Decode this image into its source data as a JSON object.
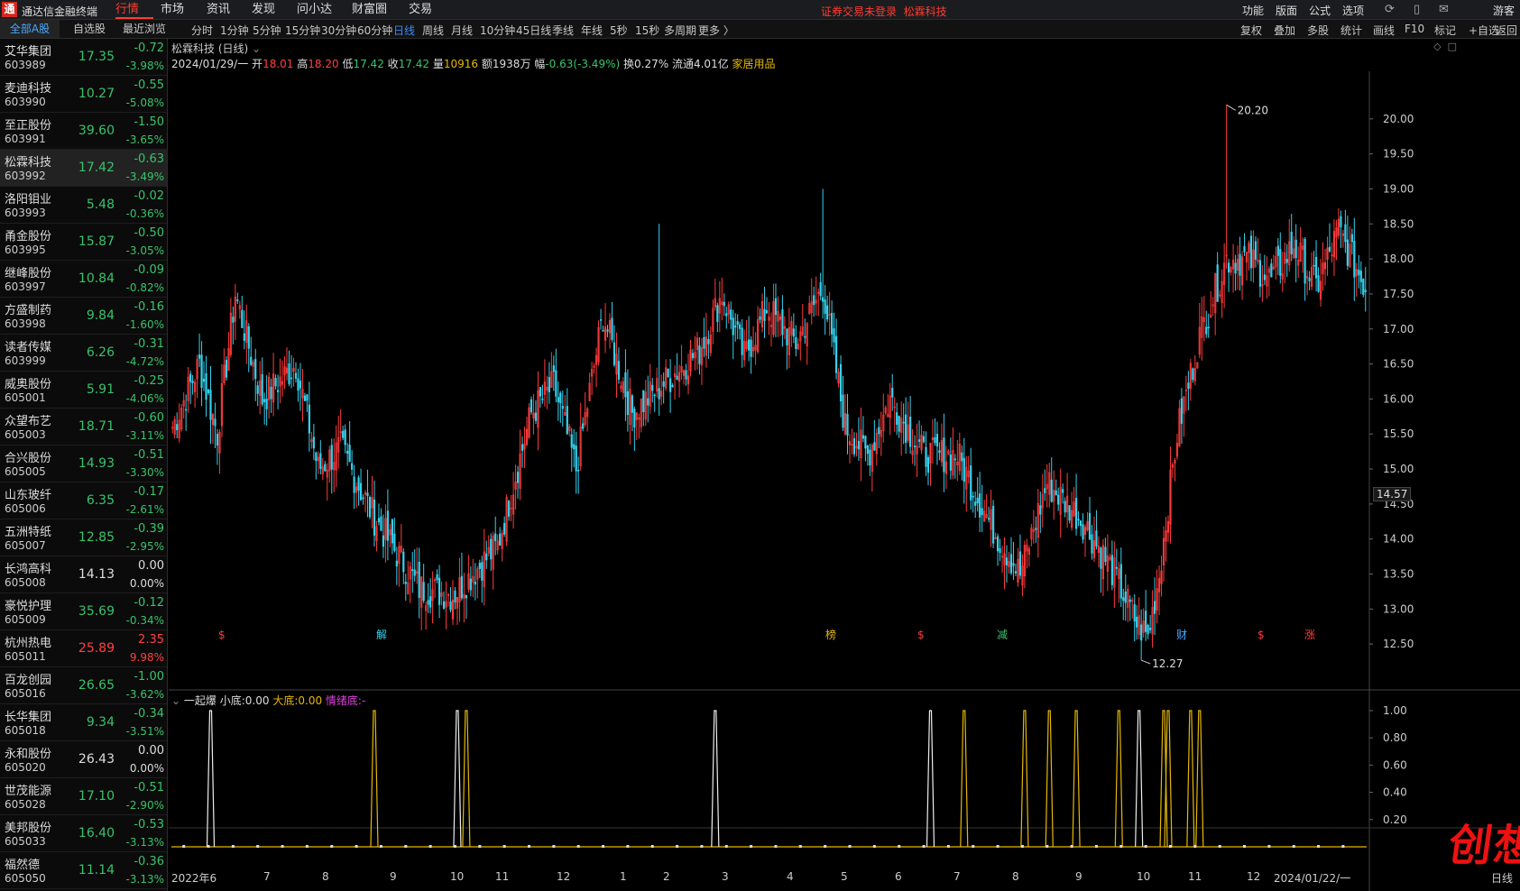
{
  "menubar": {
    "logo": "通",
    "title": "通达信金融终端",
    "items": [
      "行情",
      "市场",
      "资讯",
      "发现",
      "问小达",
      "财富圈",
      "交易"
    ],
    "active": "行情",
    "login_notice": "证券交易未登录",
    "stock_name": "松霖科技",
    "right": [
      "功能",
      "版面",
      "公式",
      "选项"
    ],
    "guest": "游客"
  },
  "subbar": {
    "tabs": [
      "全部A股",
      "自选股",
      "最近浏览"
    ],
    "periods": [
      "分时",
      "1分钟",
      "5分钟",
      "15分钟",
      "30分钟",
      "60分钟",
      "日线",
      "周线",
      "月线",
      "10分钟",
      "45日线",
      "季线",
      "年线",
      "5秒",
      "15秒",
      "多周期",
      "更多 〉"
    ],
    "active_period": "日线",
    "tools": [
      "复权",
      "叠加",
      "多股",
      "统计",
      "画线",
      "F10",
      "标记",
      "+自选",
      "返回"
    ]
  },
  "stocks": [
    {
      "name": "艾华集团",
      "code": "603989",
      "price": "17.35",
      "change": "-0.72",
      "pct": "-3.98%"
    },
    {
      "name": "麦迪科技",
      "code": "603990",
      "price": "10.27",
      "change": "-0.55",
      "pct": "-5.08%"
    },
    {
      "name": "至正股份",
      "code": "603991",
      "price": "39.60",
      "change": "-1.50",
      "pct": "-3.65%"
    },
    {
      "name": "松霖科技",
      "code": "603992",
      "price": "17.42",
      "change": "-0.63",
      "pct": "-3.49%"
    },
    {
      "name": "洛阳钼业",
      "code": "603993",
      "price": "5.48",
      "change": "-0.02",
      "pct": "-0.36%"
    },
    {
      "name": "甬金股份",
      "code": "603995",
      "price": "15.87",
      "change": "-0.50",
      "pct": "-3.05%"
    },
    {
      "name": "继峰股份",
      "code": "603997",
      "price": "10.84",
      "change": "-0.09",
      "pct": "-0.82%"
    },
    {
      "name": "方盛制药",
      "code": "603998",
      "price": "9.84",
      "change": "-0.16",
      "pct": "-1.60%"
    },
    {
      "name": "读者传媒",
      "code": "603999",
      "price": "6.26",
      "change": "-0.31",
      "pct": "-4.72%"
    },
    {
      "name": "威奥股份",
      "code": "605001",
      "price": "5.91",
      "change": "-0.25",
      "pct": "-4.06%"
    },
    {
      "name": "众望布艺",
      "code": "605003",
      "price": "18.71",
      "change": "-0.60",
      "pct": "-3.11%"
    },
    {
      "name": "合兴股份",
      "code": "605005",
      "price": "14.93",
      "change": "-0.51",
      "pct": "-3.30%"
    },
    {
      "name": "山东玻纤",
      "code": "605006",
      "price": "6.35",
      "change": "-0.17",
      "pct": "-2.61%"
    },
    {
      "name": "五洲特纸",
      "code": "605007",
      "price": "12.85",
      "change": "-0.39",
      "pct": "-2.95%"
    },
    {
      "name": "长鸿高科",
      "code": "605008",
      "price": "14.13",
      "change": "0.00",
      "pct": "0.00%"
    },
    {
      "name": "豪悦护理",
      "code": "605009",
      "price": "35.69",
      "change": "-0.12",
      "pct": "-0.34%"
    },
    {
      "name": "杭州热电",
      "code": "605011",
      "price": "25.89",
      "change": "2.35",
      "pct": "9.98%"
    },
    {
      "name": "百龙创园",
      "code": "605016",
      "price": "26.65",
      "change": "-1.00",
      "pct": "-3.62%"
    },
    {
      "name": "长华集团",
      "code": "605018",
      "price": "9.34",
      "change": "-0.34",
      "pct": "-3.51%"
    },
    {
      "name": "永和股份",
      "code": "605020",
      "price": "26.43",
      "change": "0.00",
      "pct": "0.00%"
    },
    {
      "name": "世茂能源",
      "code": "605028",
      "price": "17.10",
      "change": "-0.51",
      "pct": "-2.90%"
    },
    {
      "name": "美邦股份",
      "code": "605033",
      "price": "16.40",
      "change": "-0.53",
      "pct": "-3.13%"
    },
    {
      "name": "福然德",
      "code": "605050",
      "price": "11.14",
      "change": "-0.36",
      "pct": "-3.13%"
    }
  ],
  "chart": {
    "title": "松霖科技 (日线)",
    "date": "2024/01/29/一",
    "open_label": "开",
    "open": "18.01",
    "high_label": "高",
    "high": "18.20",
    "low_label": "低",
    "low": "17.42",
    "close_label": "收",
    "close": "17.42",
    "vol_label": "量",
    "vol": "10916",
    "amt_label": "额",
    "amt": "1938万",
    "amp_label": "幅",
    "amp": "-0.63(-3.49%)",
    "turn_label": "换",
    "turn": "0.27%",
    "float_label": "流通",
    "float": "4.01亿",
    "sector": "家居用品",
    "last_price": "14.57",
    "max_label": "20.20",
    "min_label": "12.27"
  },
  "indicator": {
    "name": "一起爆",
    "xiao_label": "小底:",
    "xiao": "0.00",
    "da_label": "大底:",
    "da": "0.00",
    "qx_label": "情绪底:",
    "qx": "-"
  },
  "events": [
    {
      "t": "$"
    },
    {
      "t": "解"
    },
    {
      "t": "榜"
    },
    {
      "t": "$"
    },
    {
      "t": "减"
    },
    {
      "t": "财"
    },
    {
      "t": "$"
    },
    {
      "t": "涨"
    }
  ],
  "x_axis": {
    "labels": [
      "2022年6",
      "7",
      "8",
      "9",
      "10",
      "11",
      "12",
      "1",
      "2",
      "3",
      "4",
      "5",
      "6",
      "7",
      "8",
      "9",
      "10",
      "11",
      "12",
      "2024/01/22/一"
    ],
    "period": "日线"
  },
  "chart_data": {
    "type": "candlestick",
    "price_axis": {
      "ticks": [
        12.5,
        13.0,
        13.5,
        14.0,
        14.5,
        15.0,
        15.5,
        16.0,
        16.5,
        17.0,
        17.5,
        18.0,
        18.5,
        19.0,
        19.5,
        20.0
      ],
      "ylim": [
        12.0,
        20.5
      ]
    },
    "indicator_axis": {
      "ticks": [
        0.2,
        0.4,
        0.6,
        0.8,
        1.0
      ],
      "ylim": [
        0,
        1
      ]
    },
    "anchors": [
      [
        0,
        15.6
      ],
      [
        12,
        16.5
      ],
      [
        20,
        15.5
      ],
      [
        28,
        17.5
      ],
      [
        40,
        16.0
      ],
      [
        55,
        16.5
      ],
      [
        65,
        15.0
      ],
      [
        75,
        15.3
      ],
      [
        90,
        14.3
      ],
      [
        110,
        13.3
      ],
      [
        125,
        13.2
      ],
      [
        145,
        13.9
      ],
      [
        160,
        15.8
      ],
      [
        170,
        16.2
      ],
      [
        180,
        15.0
      ],
      [
        192,
        17.2
      ],
      [
        205,
        15.8
      ],
      [
        215,
        16.1
      ],
      [
        235,
        16.7
      ],
      [
        245,
        17.5
      ],
      [
        255,
        16.6
      ],
      [
        265,
        17.3
      ],
      [
        278,
        16.8
      ],
      [
        290,
        17.6
      ],
      [
        300,
        15.6
      ],
      [
        310,
        15.2
      ],
      [
        320,
        16.0
      ],
      [
        335,
        15.2
      ],
      [
        350,
        15.2
      ],
      [
        365,
        14.2
      ],
      [
        378,
        13.5
      ],
      [
        390,
        14.8
      ],
      [
        405,
        14.3
      ],
      [
        420,
        13.5
      ],
      [
        430,
        12.8
      ],
      [
        435,
        12.6
      ],
      [
        440,
        13.5
      ],
      [
        448,
        15.5
      ],
      [
        458,
        16.9
      ],
      [
        470,
        18.0
      ],
      [
        480,
        18.0
      ],
      [
        490,
        17.7
      ],
      [
        500,
        18.2
      ],
      [
        510,
        17.6
      ],
      [
        520,
        18.4
      ],
      [
        532,
        17.6
      ]
    ],
    "white_signals": [
      17,
      127,
      242,
      338,
      431
    ],
    "yellow_signals": [
      90,
      131,
      353,
      380,
      391,
      403,
      422,
      442,
      444,
      454,
      458
    ]
  }
}
